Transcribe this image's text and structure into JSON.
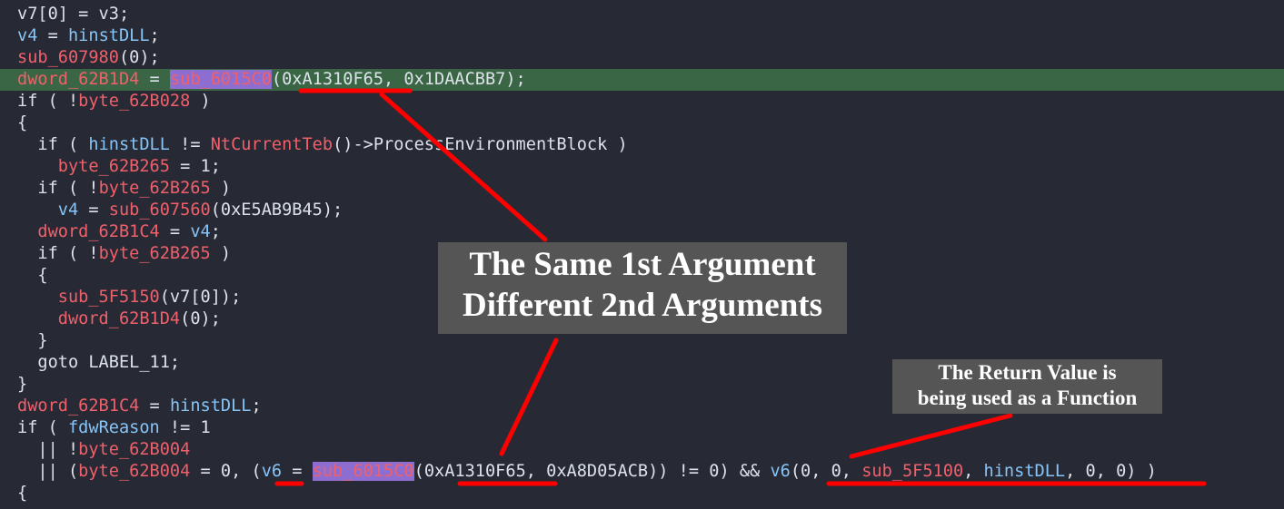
{
  "code_lines": [
    {
      "tokens": [
        {
          "t": "v7[0] = v3;",
          "c": "p"
        }
      ]
    },
    {
      "tokens": [
        {
          "t": "v4",
          "c": "v"
        },
        {
          "t": " = ",
          "c": "p"
        },
        {
          "t": "hinstDLL",
          "c": "v"
        },
        {
          "t": ";",
          "c": "p"
        }
      ]
    },
    {
      "tokens": [
        {
          "t": "sub_607980",
          "c": "g"
        },
        {
          "t": "(0);",
          "c": "p"
        }
      ]
    },
    {
      "tokens": [
        {
          "t": "dword_62B1D4",
          "c": "g"
        },
        {
          "t": " = ",
          "c": "p"
        },
        {
          "t": "sub_6015C0",
          "c": "f"
        },
        {
          "t": "(0xA1310F65, 0x1DAACBB7);",
          "c": "p"
        }
      ],
      "highlight": true
    },
    {
      "tokens": [
        {
          "t": "if ( !",
          "c": "p"
        },
        {
          "t": "byte_62B028",
          "c": "g"
        },
        {
          "t": " )",
          "c": "p"
        }
      ]
    },
    {
      "tokens": [
        {
          "t": "{",
          "c": "p"
        }
      ]
    },
    {
      "tokens": [
        {
          "t": "  if ( ",
          "c": "p"
        },
        {
          "t": "hinstDLL",
          "c": "v"
        },
        {
          "t": " != ",
          "c": "p"
        },
        {
          "t": "NtCurrentTeb",
          "c": "g"
        },
        {
          "t": "()->ProcessEnvironmentBlock )",
          "c": "p"
        }
      ]
    },
    {
      "tokens": [
        {
          "t": "    ",
          "c": "p"
        },
        {
          "t": "byte_62B265",
          "c": "g"
        },
        {
          "t": " = 1;",
          "c": "p"
        }
      ]
    },
    {
      "tokens": [
        {
          "t": "  if ( !",
          "c": "p"
        },
        {
          "t": "byte_62B265",
          "c": "g"
        },
        {
          "t": " )",
          "c": "p"
        }
      ]
    },
    {
      "tokens": [
        {
          "t": "    ",
          "c": "p"
        },
        {
          "t": "v4",
          "c": "v"
        },
        {
          "t": " = ",
          "c": "p"
        },
        {
          "t": "sub_607560",
          "c": "g"
        },
        {
          "t": "(0xE5AB9B45);",
          "c": "p"
        }
      ]
    },
    {
      "tokens": [
        {
          "t": "  ",
          "c": "p"
        },
        {
          "t": "dword_62B1C4",
          "c": "g"
        },
        {
          "t": " = ",
          "c": "p"
        },
        {
          "t": "v4",
          "c": "v"
        },
        {
          "t": ";",
          "c": "p"
        }
      ]
    },
    {
      "tokens": [
        {
          "t": "  if ( !",
          "c": "p"
        },
        {
          "t": "byte_62B265",
          "c": "g"
        },
        {
          "t": " )",
          "c": "p"
        }
      ]
    },
    {
      "tokens": [
        {
          "t": "  {",
          "c": "p"
        }
      ]
    },
    {
      "tokens": [
        {
          "t": "    ",
          "c": "p"
        },
        {
          "t": "sub_5F5150",
          "c": "g"
        },
        {
          "t": "(v7[0]);",
          "c": "p"
        }
      ]
    },
    {
      "tokens": [
        {
          "t": "    ",
          "c": "p"
        },
        {
          "t": "dword_62B1D4",
          "c": "g"
        },
        {
          "t": "(0);",
          "c": "p"
        }
      ]
    },
    {
      "tokens": [
        {
          "t": "  }",
          "c": "p"
        }
      ]
    },
    {
      "tokens": [
        {
          "t": "  goto LABEL_11;",
          "c": "p"
        }
      ]
    },
    {
      "tokens": [
        {
          "t": "}",
          "c": "p"
        }
      ]
    },
    {
      "tokens": [
        {
          "t": "dword_62B1C4",
          "c": "g"
        },
        {
          "t": " = ",
          "c": "p"
        },
        {
          "t": "hinstDLL",
          "c": "v"
        },
        {
          "t": ";",
          "c": "p"
        }
      ]
    },
    {
      "tokens": [
        {
          "t": "if ( ",
          "c": "p"
        },
        {
          "t": "fdwReason",
          "c": "v"
        },
        {
          "t": " != 1",
          "c": "p"
        }
      ]
    },
    {
      "tokens": [
        {
          "t": "  || !",
          "c": "p"
        },
        {
          "t": "byte_62B004",
          "c": "g"
        }
      ]
    },
    {
      "tokens": [
        {
          "t": "  || (",
          "c": "p"
        },
        {
          "t": "byte_62B004",
          "c": "g"
        },
        {
          "t": " = 0, (",
          "c": "p"
        },
        {
          "t": "v6",
          "c": "v"
        },
        {
          "t": " = ",
          "c": "p"
        },
        {
          "t": "sub_6015C0",
          "c": "f"
        },
        {
          "t": "(0xA1310F65, 0xA8D05ACB)) != 0) && ",
          "c": "p"
        },
        {
          "t": "v6",
          "c": "v"
        },
        {
          "t": "(0, 0, ",
          "c": "p"
        },
        {
          "t": "sub_5F5100",
          "c": "g"
        },
        {
          "t": ", ",
          "c": "p"
        },
        {
          "t": "hinstDLL",
          "c": "v"
        },
        {
          "t": ", 0, 0) )",
          "c": "p"
        }
      ]
    },
    {
      "tokens": [
        {
          "t": "{",
          "c": "p"
        }
      ]
    }
  ],
  "annotations": {
    "same_first_arg": {
      "line1": "The Same 1st Argument",
      "line2": "Different 2nd Arguments"
    },
    "return_value": {
      "line1": "The Return Value is",
      "line2": "being used as a Function"
    }
  },
  "colors": {
    "background": "#272a35",
    "line_highlight": "#3a6645",
    "keyword_plain": "#dde2ea",
    "variable": "#88c4f6",
    "global_or_function": "#f0606a",
    "function_selection": "#8d6ed0",
    "annotation_box": "#555555",
    "annotation_mark": "#ff0000"
  }
}
